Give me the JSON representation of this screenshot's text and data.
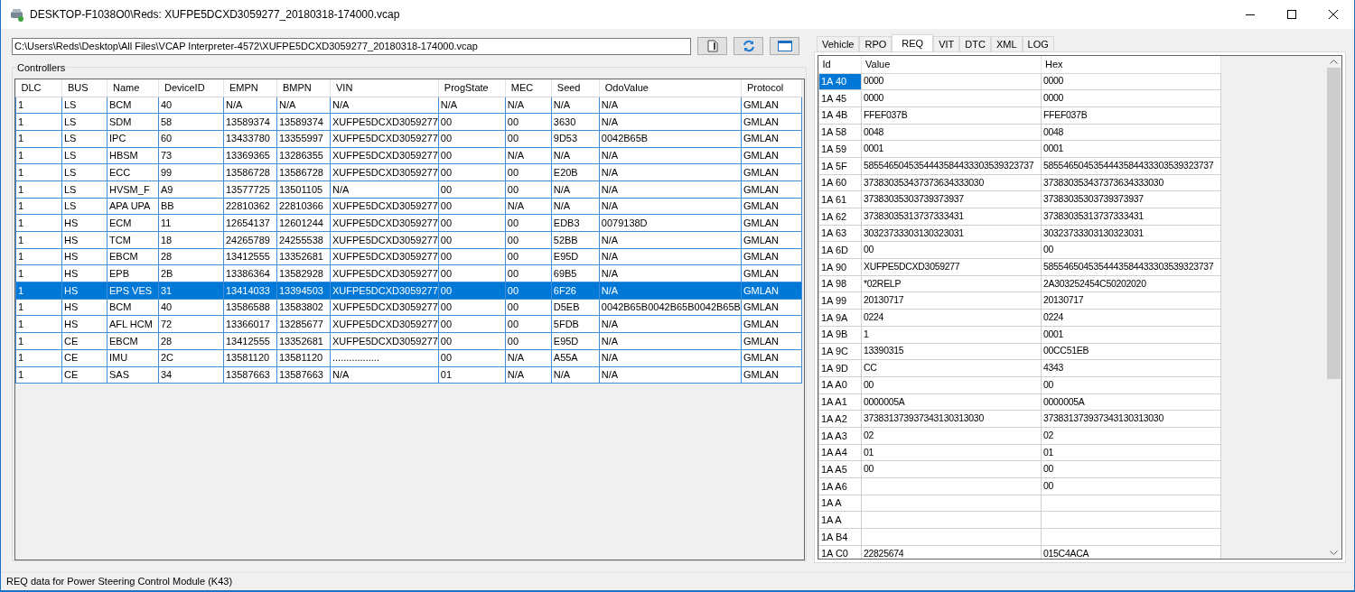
{
  "window": {
    "title": "DESKTOP-F1038O0\\Reds: XUFPE5DCXD3059277_20180318-174000.vcap"
  },
  "path_field": {
    "value": "C:\\Users\\Reds\\Desktop\\All Files\\VCAP Interpreter-4572\\XUFPE5DCXD3059277_20180318-174000.vcap"
  },
  "controllers": {
    "title": "Controllers",
    "columns": [
      "DLC",
      "BUS",
      "Name",
      "DeviceID",
      "EMPN",
      "BMPN",
      "VIN",
      "ProgState",
      "MEC",
      "Seed",
      "OdoValue",
      "Protocol"
    ],
    "rows": [
      {
        "selected": false,
        "cells": [
          "1",
          "LS",
          "BCM",
          "40",
          "N/A",
          "N/A",
          "N/A",
          "N/A",
          "N/A",
          "N/A",
          "N/A",
          "GMLAN"
        ]
      },
      {
        "selected": false,
        "cells": [
          "1",
          "LS",
          "SDM",
          "58",
          "13589374",
          "13589374",
          "XUFPE5DCXD3059277",
          "00",
          "00",
          "3630",
          "N/A",
          "GMLAN"
        ]
      },
      {
        "selected": false,
        "cells": [
          "1",
          "LS",
          "IPC",
          "60",
          "13433780",
          "13355997",
          "XUFPE5DCXD3059277",
          "00",
          "00",
          "9D53",
          "0042B65B",
          "GMLAN"
        ]
      },
      {
        "selected": false,
        "cells": [
          "1",
          "LS",
          "HBSM",
          "73",
          "13369365",
          "13286355",
          "XUFPE5DCXD3059277",
          "00",
          "N/A",
          "N/A",
          "N/A",
          "GMLAN"
        ]
      },
      {
        "selected": false,
        "cells": [
          "1",
          "LS",
          "ECC",
          "99",
          "13586728",
          "13586728",
          "XUFPE5DCXD3059277",
          "00",
          "00",
          "E20B",
          "N/A",
          "GMLAN"
        ]
      },
      {
        "selected": false,
        "cells": [
          "1",
          "LS",
          "HVSM_F",
          "A9",
          "13577725",
          "13501105",
          "N/A",
          "00",
          "00",
          "N/A",
          "N/A",
          "GMLAN"
        ]
      },
      {
        "selected": false,
        "cells": [
          "1",
          "LS",
          "APA UPA",
          "BB",
          "22810362",
          "22810366",
          "XUFPE5DCXD3059277",
          "00",
          "N/A",
          "N/A",
          "N/A",
          "GMLAN"
        ]
      },
      {
        "selected": false,
        "cells": [
          "1",
          "HS",
          "ECM",
          "11",
          "12654137",
          "12601244",
          "XUFPE5DCXD3059277",
          "00",
          "00",
          "EDB3",
          "0079138D",
          "GMLAN"
        ]
      },
      {
        "selected": false,
        "cells": [
          "1",
          "HS",
          "TCM",
          "18",
          "24265789",
          "24255538",
          "XUFPE5DCXD3059277",
          "00",
          "00",
          "52BB",
          "N/A",
          "GMLAN"
        ]
      },
      {
        "selected": false,
        "cells": [
          "1",
          "HS",
          "EBCM",
          "28",
          "13412555",
          "13352681",
          "XUFPE5DCXD3059277",
          "00",
          "00",
          "E95D",
          "N/A",
          "GMLAN"
        ]
      },
      {
        "selected": false,
        "cells": [
          "1",
          "HS",
          "EPB",
          "2B",
          "13386364",
          "13582928",
          "XUFPE5DCXD3059277",
          "00",
          "00",
          "69B5",
          "N/A",
          "GMLAN"
        ]
      },
      {
        "selected": true,
        "cells": [
          "1",
          "HS",
          "EPS VES",
          "31",
          "13414033",
          "13394503",
          "XUFPE5DCXD3059277",
          "00",
          "00",
          "6F26",
          "N/A",
          "GMLAN"
        ]
      },
      {
        "selected": false,
        "cells": [
          "1",
          "HS",
          "BCM",
          "40",
          "13586588",
          "13583802",
          "XUFPE5DCXD3059277",
          "00",
          "00",
          "D5EB",
          "0042B65B0042B65B0042B65B",
          "GMLAN"
        ]
      },
      {
        "selected": false,
        "cells": [
          "1",
          "HS",
          "AFL HCM",
          "72",
          "13366017",
          "13285677",
          "XUFPE5DCXD3059277",
          "00",
          "00",
          "5FDB",
          "N/A",
          "GMLAN"
        ]
      },
      {
        "selected": false,
        "cells": [
          "1",
          "CE",
          "EBCM",
          "28",
          "13412555",
          "13352681",
          "XUFPE5DCXD3059277",
          "00",
          "00",
          "E95D",
          "N/A",
          "GMLAN"
        ]
      },
      {
        "selected": false,
        "cells": [
          "1",
          "CE",
          "IMU",
          "2C",
          "13581120",
          "13581120",
          ".................",
          "00",
          "N/A",
          "A55A",
          "N/A",
          "GMLAN"
        ]
      },
      {
        "selected": false,
        "cells": [
          "1",
          "CE",
          "SAS",
          "34",
          "13587663",
          "13587663",
          "N/A",
          "01",
          "N/A",
          "N/A",
          "N/A",
          "GMLAN"
        ]
      }
    ]
  },
  "tabs": [
    {
      "label": "Vehicle",
      "selected": false
    },
    {
      "label": "RPO",
      "selected": false
    },
    {
      "label": "REQ",
      "selected": true
    },
    {
      "label": "VIT",
      "selected": false
    },
    {
      "label": "DTC",
      "selected": false
    },
    {
      "label": "XML",
      "selected": false
    },
    {
      "label": "LOG",
      "selected": false
    }
  ],
  "req": {
    "columns": [
      "Id",
      "Value",
      "Hex"
    ],
    "rows": [
      {
        "selected": true,
        "id": "1A 40",
        "value": "0000",
        "hex": "0000"
      },
      {
        "selected": false,
        "id": "1A 45",
        "value": "0000",
        "hex": "0000"
      },
      {
        "selected": false,
        "id": "1A 4B",
        "value": "FFEF037B",
        "hex": "FFEF037B"
      },
      {
        "selected": false,
        "id": "1A 58",
        "value": "0048",
        "hex": "0048"
      },
      {
        "selected": false,
        "id": "1A 59",
        "value": "0001",
        "hex": "0001"
      },
      {
        "selected": false,
        "id": "1A 5F",
        "value": "5855465045354443584433303539323737",
        "hex": "5855465045354443584433303539323737"
      },
      {
        "selected": false,
        "id": "1A 60",
        "value": "373830353437373634333030",
        "hex": "373830353437373634333030"
      },
      {
        "selected": false,
        "id": "1A 61",
        "value": "37383035303739373937",
        "hex": "37383035303739373937"
      },
      {
        "selected": false,
        "id": "1A 62",
        "value": "37383035313737333431",
        "hex": "37383035313737333431"
      },
      {
        "selected": false,
        "id": "1A 63",
        "value": "30323733303130323031",
        "hex": "30323733303130323031"
      },
      {
        "selected": false,
        "id": "1A 6D",
        "value": "00",
        "hex": "00"
      },
      {
        "selected": false,
        "id": "1A 90",
        "value": "XUFPE5DCXD3059277",
        "hex": "5855465045354443584433303539323737"
      },
      {
        "selected": false,
        "id": "1A 98",
        "value": "*02RELP",
        "hex": "2A303252454C50202020"
      },
      {
        "selected": false,
        "id": "1A 99",
        "value": "20130717",
        "hex": "20130717"
      },
      {
        "selected": false,
        "id": "1A 9A",
        "value": "0224",
        "hex": "0224"
      },
      {
        "selected": false,
        "id": "1A 9B",
        "value": "1",
        "hex": "0001"
      },
      {
        "selected": false,
        "id": "1A 9C",
        "value": "13390315",
        "hex": "00CC51EB"
      },
      {
        "selected": false,
        "id": "1A 9D",
        "value": "CC",
        "hex": "4343"
      },
      {
        "selected": false,
        "id": "1A A0",
        "value": "00",
        "hex": "00"
      },
      {
        "selected": false,
        "id": "1A A1",
        "value": "0000005A",
        "hex": "0000005A"
      },
      {
        "selected": false,
        "id": "1A A2",
        "value": "373831373937343130313030",
        "hex": "373831373937343130313030"
      },
      {
        "selected": false,
        "id": "1A A3",
        "value": "02",
        "hex": "02"
      },
      {
        "selected": false,
        "id": "1A A4",
        "value": "01",
        "hex": "01"
      },
      {
        "selected": false,
        "id": "1A A5",
        "value": "00",
        "hex": "00"
      },
      {
        "selected": false,
        "id": "1A A6",
        "hex": "00"
      },
      {
        "selected": false,
        "id": "1A A"
      },
      {
        "selected": false,
        "id": "1A A"
      },
      {
        "selected": false,
        "id": "1A B4"
      },
      {
        "selected": false,
        "id": "1A C0",
        "value": "22825674",
        "hex": "015C4ACA"
      }
    ]
  },
  "status_bar": {
    "text": "REQ data for Power Steering Control Module (K43)"
  }
}
